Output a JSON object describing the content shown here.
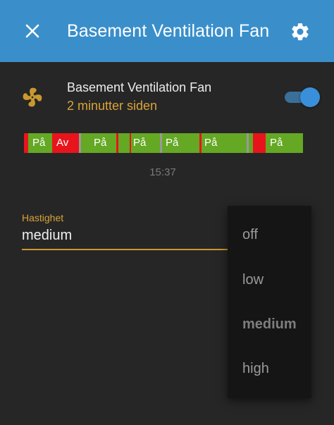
{
  "header": {
    "title": "Basement Ventilation Fan",
    "close_icon": "close-icon",
    "settings_icon": "gear-icon",
    "background": "#3a8fcb"
  },
  "entity": {
    "icon": "fan-icon",
    "icon_color": "#c9992f",
    "name": "Basement Ventilation Fan",
    "last_changed": "2 minutter siden",
    "state_on": true
  },
  "history": {
    "colors": {
      "on": "#64a824",
      "off": "#e8141c",
      "unknown": "#999999"
    },
    "segments": [
      {
        "state": "off"
      },
      {
        "state": "on",
        "label": "På"
      },
      {
        "state": "off",
        "label": "Av"
      },
      {
        "state": "unknown"
      },
      {
        "state": "on",
        "label": "På"
      },
      {
        "state": "off"
      },
      {
        "state": "on",
        "label": "På"
      },
      {
        "state": "off"
      },
      {
        "state": "unknown"
      },
      {
        "state": "on",
        "label": "På"
      },
      {
        "state": "off"
      },
      {
        "state": "on",
        "label": "På"
      },
      {
        "state": "unknown"
      },
      {
        "state": "off"
      },
      {
        "state": "on",
        "label": "På"
      }
    ],
    "time_label": "15:37"
  },
  "speed": {
    "label": "Hastighet",
    "value": "medium",
    "options": [
      "off",
      "low",
      "medium",
      "high"
    ],
    "selected": "medium"
  }
}
